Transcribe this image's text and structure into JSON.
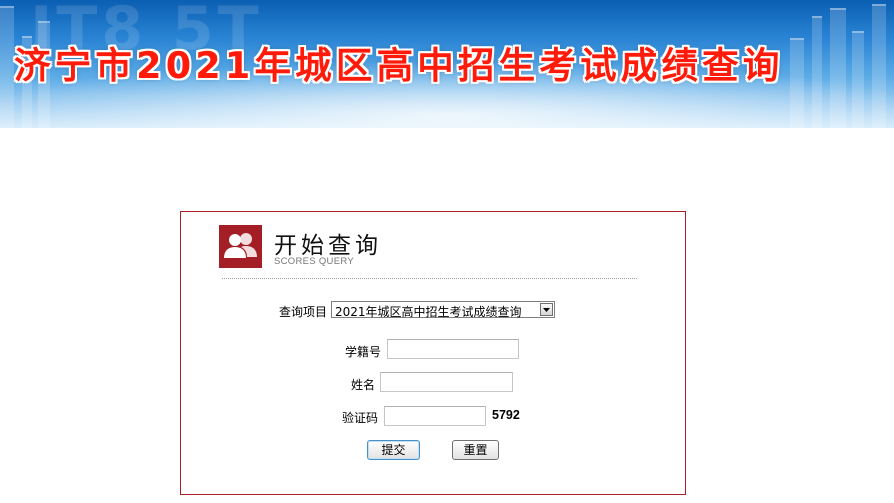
{
  "banner": {
    "title": "济宁市2021年城区高中招生考试成绩查询"
  },
  "panel": {
    "heading": "开始查询",
    "subheading": "SCORES QUERY",
    "icon": "users-icon"
  },
  "form": {
    "project_label": "查询项目",
    "project_selected": "2021年城区高中招生考试成绩查询",
    "student_id_label": "学籍号",
    "student_id_value": "",
    "name_label": "姓名",
    "name_value": "",
    "captcha_label": "验证码",
    "captcha_value": "",
    "captcha_code": "5792",
    "submit_label": "提交",
    "reset_label": "重置"
  },
  "colors": {
    "banner_text": "#ff1a0a",
    "panel_border": "#a8202a",
    "icon_bg": "#a41e26"
  }
}
